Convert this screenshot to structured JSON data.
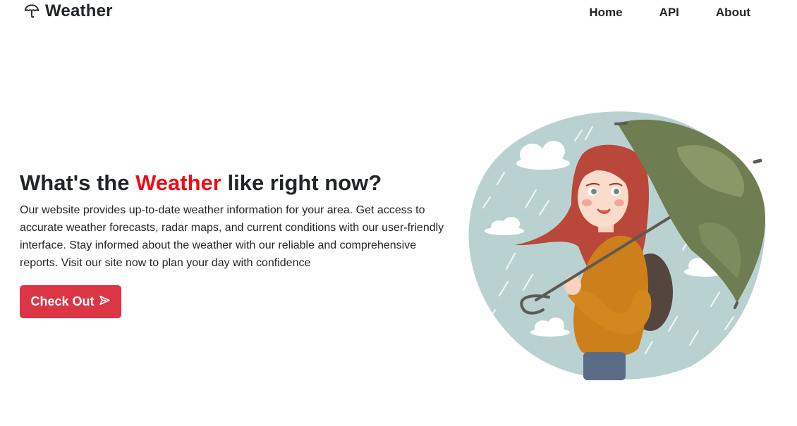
{
  "navbar": {
    "brand": "Weather",
    "links": [
      {
        "label": "Home"
      },
      {
        "label": "API"
      },
      {
        "label": "About"
      }
    ]
  },
  "hero": {
    "title_before": "What's the ",
    "title_accent": "Weather",
    "title_after": " like right now?",
    "description": "Our website provides up-to-date weather information for your area. Get access to accurate weather forecasts, radar maps, and current conditions with our user-friendly interface. Stay informed about the weather with our reliable and comprehensive reports. Visit our site now to plan your day with confidence",
    "cta_label": "Check Out"
  },
  "icons": {
    "brand": "umbrella-icon",
    "cta": "send-icon",
    "illustration": "girl-with-umbrella-in-rain-illustration"
  },
  "colors": {
    "accent": "#ee0e17",
    "button": "#dc3545",
    "text": "#212529",
    "illustration_bg": "#b9d2d1",
    "umbrella": "#6f7e52",
    "hair": "#b9473a",
    "sweater": "#cc7f1b"
  }
}
